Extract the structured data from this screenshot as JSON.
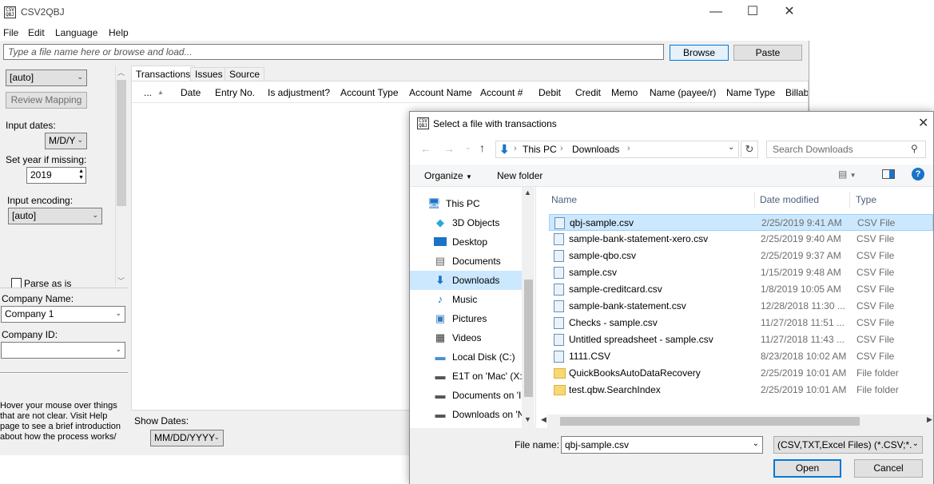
{
  "app": {
    "title": "CSV2QBJ",
    "icon_text": "CSV QBJ",
    "window_controls": [
      "—",
      "☐",
      "✕"
    ]
  },
  "menu": [
    "File",
    "Edit",
    "Language",
    "Help"
  ],
  "toolbar": {
    "file_placeholder": "Type a file name here or browse and load...",
    "browse_label": "Browse",
    "paste_label": "Paste"
  },
  "left_panel": {
    "mapping_combo": "[auto]",
    "review_mapping_label": "Review Mapping",
    "input_dates_label": "Input dates:",
    "date_format": "M/D/Y",
    "set_year_label": "Set year if missing:",
    "year_value": "2019",
    "input_encoding_label": "Input encoding:",
    "encoding_value": "[auto]",
    "parse_as_is_label": "Parse as is",
    "company_name_label": "Company Name:",
    "company_name_value": "Company 1",
    "company_id_label": "Company ID:",
    "company_id_value": "",
    "help_text": "Hover your mouse over things that are not clear. Visit Help page to see a brief introduction about how the process works/"
  },
  "tabs": [
    "Transactions",
    "Issues",
    "Source"
  ],
  "grid_columns": [
    "...",
    "Date",
    "Entry No.",
    "Is adjustment?",
    "Account Type",
    "Account Name",
    "Account #",
    "Debit",
    "Credit",
    "Memo",
    "Name (payee/r)",
    "Name Type",
    "Billab"
  ],
  "show_dates": {
    "label": "Show Dates:",
    "value": "MM/DD/YYYY"
  },
  "dialog": {
    "title": "Select a file with transactions",
    "icon_text": "CSV QBJ",
    "breadcrumb": [
      "This PC",
      "Downloads"
    ],
    "search_placeholder": "Search Downloads",
    "organize_label": "Organize",
    "new_folder_label": "New folder",
    "nav_items": [
      {
        "label": "This PC",
        "icon": "computer-icon"
      },
      {
        "label": "3D Objects",
        "icon": "cube-icon"
      },
      {
        "label": "Desktop",
        "icon": "desktop-icon"
      },
      {
        "label": "Documents",
        "icon": "document-icon"
      },
      {
        "label": "Downloads",
        "icon": "download-icon"
      },
      {
        "label": "Music",
        "icon": "music-icon"
      },
      {
        "label": "Pictures",
        "icon": "picture-icon"
      },
      {
        "label": "Videos",
        "icon": "video-icon"
      },
      {
        "label": "Local Disk (C:)",
        "icon": "disk-icon"
      },
      {
        "label": "E1T on 'Mac' (X:",
        "icon": "network-drive-icon"
      },
      {
        "label": "Documents on 'I",
        "icon": "network-drive-icon"
      },
      {
        "label": "Downloads on 'N",
        "icon": "network-drive-icon"
      }
    ],
    "columns": {
      "name": "Name",
      "date": "Date modified",
      "type": "Type"
    },
    "files": [
      {
        "name": "qbj-sample.csv",
        "date": "2/25/2019 9:41 AM",
        "type": "CSV File",
        "kind": "file"
      },
      {
        "name": "sample-bank-statement-xero.csv",
        "date": "2/25/2019 9:40 AM",
        "type": "CSV File",
        "kind": "file"
      },
      {
        "name": "sample-qbo.csv",
        "date": "2/25/2019 9:37 AM",
        "type": "CSV File",
        "kind": "file"
      },
      {
        "name": "sample.csv",
        "date": "1/15/2019 9:48 AM",
        "type": "CSV File",
        "kind": "file"
      },
      {
        "name": "sample-creditcard.csv",
        "date": "1/8/2019 10:05 AM",
        "type": "CSV File",
        "kind": "file"
      },
      {
        "name": "sample-bank-statement.csv",
        "date": "12/28/2018 11:30 ...",
        "type": "CSV File",
        "kind": "file"
      },
      {
        "name": "Checks - sample.csv",
        "date": "11/27/2018 11:51 ...",
        "type": "CSV File",
        "kind": "file"
      },
      {
        "name": "Untitled spreadsheet - sample.csv",
        "date": "11/27/2018 11:43 ...",
        "type": "CSV File",
        "kind": "file"
      },
      {
        "name": "1111.CSV",
        "date": "8/23/2018 10:02 AM",
        "type": "CSV File",
        "kind": "file"
      },
      {
        "name": "QuickBooksAutoDataRecovery",
        "date": "2/25/2019 10:01 AM",
        "type": "File folder",
        "kind": "folder"
      },
      {
        "name": "test.qbw.SearchIndex",
        "date": "2/25/2019 10:01 AM",
        "type": "File folder",
        "kind": "folder"
      }
    ],
    "selected_file_index": 0,
    "file_name_label": "File name:",
    "file_name_value": "qbj-sample.csv",
    "file_type_value": "(CSV,TXT,Excel Files) (*.CSV;*.T:",
    "open_label": "Open",
    "cancel_label": "Cancel"
  }
}
